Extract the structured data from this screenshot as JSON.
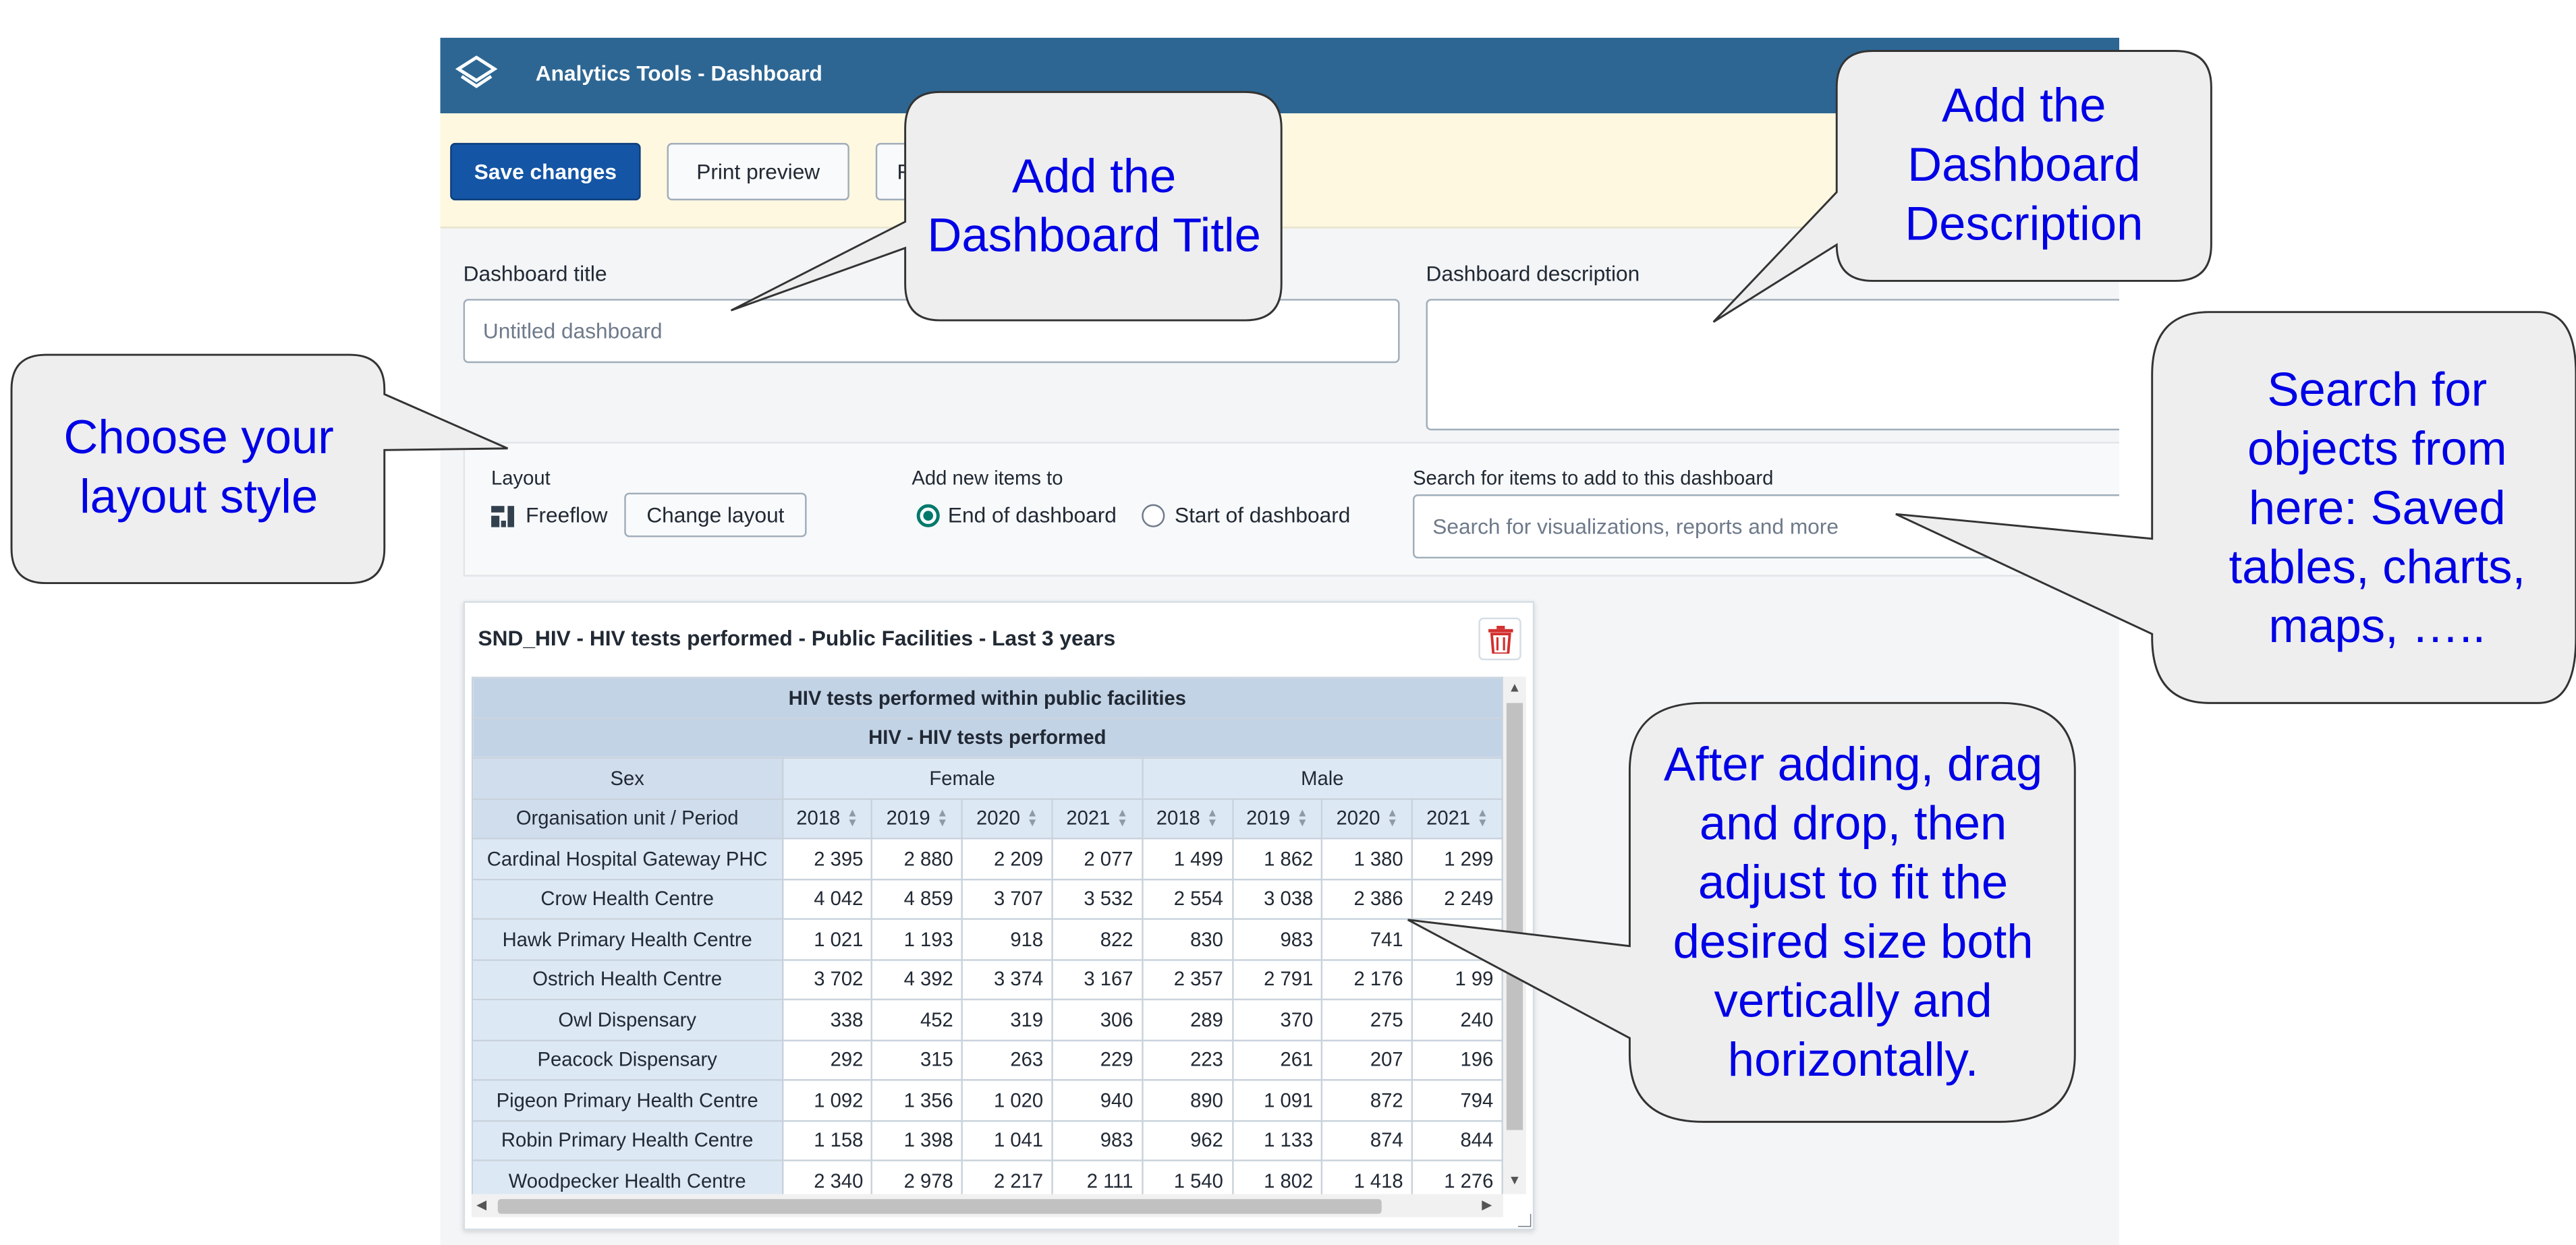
{
  "app": {
    "title": "Analytics Tools - Dashboard"
  },
  "toolbar": {
    "save_label": "Save changes",
    "print_label": "Print preview",
    "third_label": "F"
  },
  "form": {
    "title_label": "Dashboard title",
    "title_placeholder": "Untitled dashboard",
    "description_label": "Dashboard description",
    "description_value": ""
  },
  "layout": {
    "section_label": "Layout",
    "current": "Freeflow",
    "change_label": "Change layout",
    "add_label": "Add new items to",
    "options": [
      {
        "label": "End of dashboard",
        "checked": true
      },
      {
        "label": "Start of dashboard",
        "checked": false
      }
    ],
    "search_label": "Search for items to add to this dashboard",
    "search_placeholder": "Search for visualizations, reports and more"
  },
  "item": {
    "title": "SND_HIV - HIV tests performed - Public Facilities - Last 3 years",
    "table_title": "HIV tests performed within public facilities",
    "data_element": "HIV - HIV tests performed",
    "dim_label": "Sex",
    "groups": [
      "Female",
      "Male"
    ],
    "corner_label": "Organisation unit / Period",
    "periods": [
      "2018",
      "2019",
      "2020",
      "2021",
      "2018",
      "2019",
      "2020",
      "2021"
    ],
    "rows": [
      {
        "name": "Cardinal Hospital Gateway PHC",
        "values": [
          "2 395",
          "2 880",
          "2 209",
          "2 077",
          "1 499",
          "1 862",
          "1 380",
          "1 299"
        ]
      },
      {
        "name": "Crow Health Centre",
        "values": [
          "4 042",
          "4 859",
          "3 707",
          "3 532",
          "2 554",
          "3 038",
          "2 386",
          "2 249"
        ]
      },
      {
        "name": "Hawk Primary Health Centre",
        "values": [
          "1 021",
          "1 193",
          "918",
          "822",
          "830",
          "983",
          "741",
          ""
        ]
      },
      {
        "name": "Ostrich Health Centre",
        "values": [
          "3 702",
          "4 392",
          "3 374",
          "3 167",
          "2 357",
          "2 791",
          "2 176",
          "1 99"
        ]
      },
      {
        "name": "Owl Dispensary",
        "values": [
          "338",
          "452",
          "319",
          "306",
          "289",
          "370",
          "275",
          "240"
        ]
      },
      {
        "name": "Peacock Dispensary",
        "values": [
          "292",
          "315",
          "263",
          "229",
          "223",
          "261",
          "207",
          "196"
        ]
      },
      {
        "name": "Pigeon Primary Health Centre",
        "values": [
          "1 092",
          "1 356",
          "1 020",
          "940",
          "890",
          "1 091",
          "872",
          "794"
        ]
      },
      {
        "name": "Robin Primary Health Centre",
        "values": [
          "1 158",
          "1 398",
          "1 041",
          "983",
          "962",
          "1 133",
          "874",
          "844"
        ]
      },
      {
        "name": "Woodpecker Health Centre",
        "values": [
          "2 340",
          "2 978",
          "2 217",
          "2 111",
          "1 540",
          "1 802",
          "1 418",
          "1 276"
        ]
      }
    ]
  },
  "callouts": {
    "title": "Add the Dashboard Title",
    "description": "Add the Dashboard Description",
    "layout": "Choose your layout style",
    "search": "Search for objects from here: Saved tables, charts, maps, …..",
    "resize": "After adding, drag and drop, then adjust to fit the desired size both vertically and horizontally."
  },
  "icons": {
    "logo": "layers-logo-icon",
    "layout": "freeflow-layout-icon",
    "delete": "trash-icon"
  },
  "colors": {
    "header": "#2d6693",
    "primary_button": "#1455a5",
    "callout_text": "#0000e6",
    "trash": "#d32f2f"
  }
}
